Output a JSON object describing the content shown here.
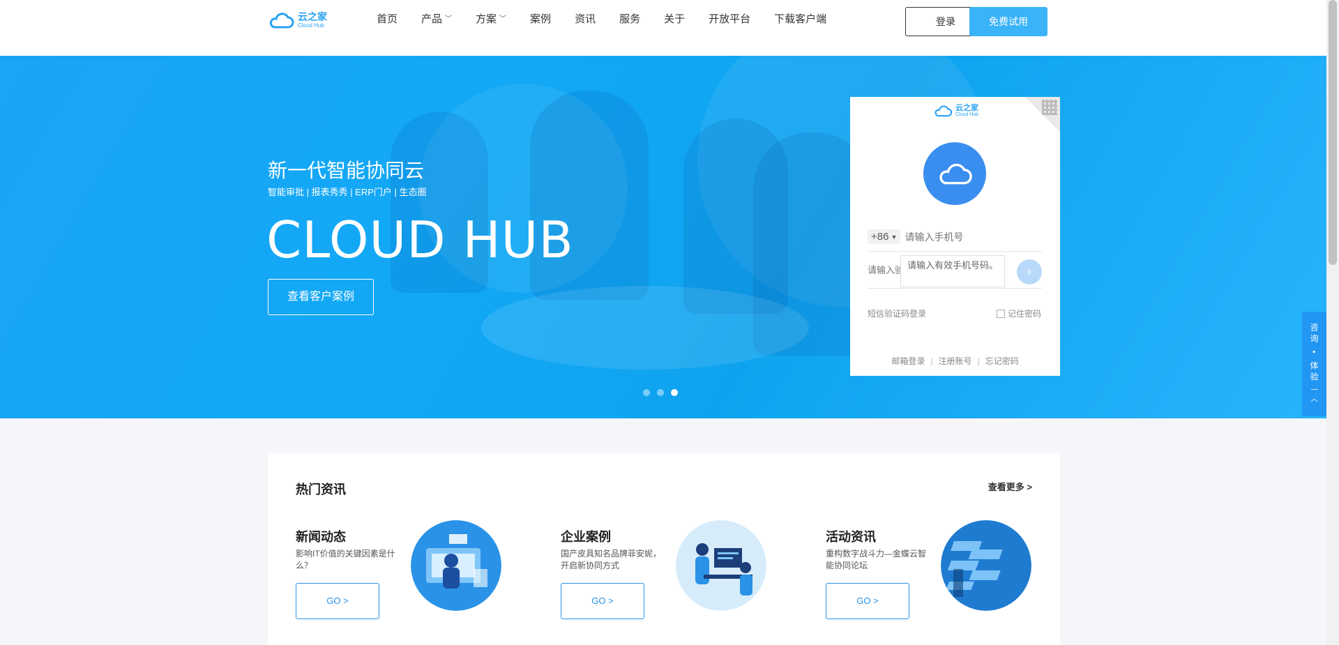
{
  "brand": {
    "name_cn": "云之家",
    "name_en": "Cloud Hub",
    "color": "#29a3f3"
  },
  "nav": {
    "items": [
      {
        "label": "首页",
        "dropdown": false
      },
      {
        "label": "产品",
        "dropdown": true
      },
      {
        "label": "方案",
        "dropdown": true
      },
      {
        "label": "案例",
        "dropdown": false
      },
      {
        "label": "资讯",
        "dropdown": false
      },
      {
        "label": "服务",
        "dropdown": false
      },
      {
        "label": "关于",
        "dropdown": false
      },
      {
        "label": "开放平台",
        "dropdown": false
      },
      {
        "label": "下载客户端",
        "dropdown": false
      }
    ],
    "login_label": "登录",
    "trial_label": "免费试用"
  },
  "hero": {
    "subtitle": "新一代智能协同云",
    "tags": "智能审批 | 报表秀秀 | ERP门户 | 生态圈",
    "headline": "CLOUD HUB",
    "cta_label": "查看客户案例",
    "slides": 3,
    "active_slide": 3
  },
  "login_card": {
    "country_code": "+86",
    "phone_placeholder": "请输入手机号",
    "code_placeholder": "请输入验",
    "tooltip": "请输入有效手机号码。",
    "sms_login": "短信验证码登录",
    "remember": "记住密码",
    "links": [
      "邮箱登录",
      "注册账号",
      "忘记密码"
    ]
  },
  "side_float": {
    "label": "咨询 • 体验"
  },
  "news": {
    "title": "热门资讯",
    "more": "查看更多 >",
    "cards": [
      {
        "title": "新闻动态",
        "desc": "影响IT价值的关键因素是什么？",
        "button": "GO >"
      },
      {
        "title": "企业案例",
        "desc": "国产皮具知名品牌菲安妮，开启新协同方式",
        "button": "GO >"
      },
      {
        "title": "活动资讯",
        "desc": "重构数字战斗力—金蝶云智能协同论坛",
        "button": "GO >"
      }
    ]
  }
}
